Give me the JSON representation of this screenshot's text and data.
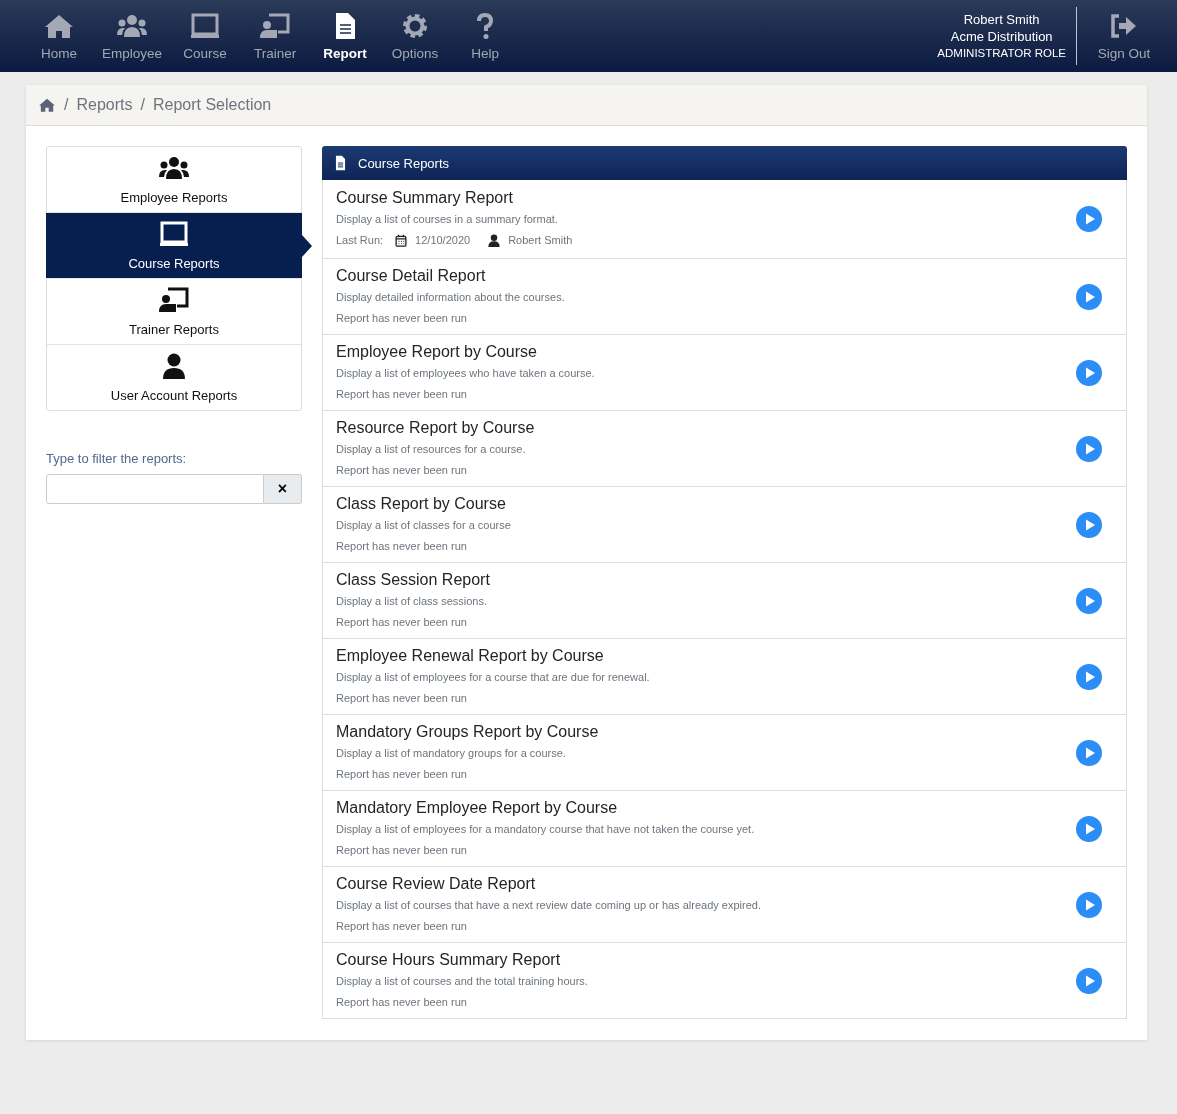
{
  "nav": [
    {
      "label": "Home",
      "kind": "home",
      "selected": false
    },
    {
      "label": "Employee",
      "kind": "users",
      "selected": false
    },
    {
      "label": "Course",
      "kind": "board",
      "selected": false
    },
    {
      "label": "Trainer",
      "kind": "trainer",
      "selected": false
    },
    {
      "label": "Report",
      "kind": "file",
      "selected": true
    },
    {
      "label": "Options",
      "kind": "gear",
      "selected": false
    },
    {
      "label": "Help",
      "kind": "help",
      "selected": false
    }
  ],
  "user": {
    "name": "Robert Smith",
    "company": "Acme Distribution",
    "role": "ADMINISTRATOR ROLE"
  },
  "sign_out": {
    "label": "Sign Out"
  },
  "breadcrumb": [
    {
      "separator": "/",
      "label": "Reports"
    },
    {
      "separator": "/",
      "label": "Report Selection"
    }
  ],
  "categories": [
    {
      "label": "Employee Reports",
      "kind": "users",
      "selected": false
    },
    {
      "label": "Course Reports",
      "kind": "board",
      "selected": true
    },
    {
      "label": "Trainer Reports",
      "kind": "trainer",
      "selected": false
    },
    {
      "label": "User Account Reports",
      "kind": "user",
      "selected": false
    }
  ],
  "filter": {
    "label": "Type to filter the reports:",
    "clear": "×"
  },
  "panel": {
    "title": "Course Reports"
  },
  "reports": [
    {
      "title": "Course Summary Report",
      "description": "Display a list of courses in a summary format.",
      "last_run": {
        "label": "Last Run:",
        "date": "12/10/2020",
        "user": "Robert Smith"
      }
    },
    {
      "title": "Course Detail Report",
      "description": "Display detailed information about the courses.",
      "status": "Report has never been run"
    },
    {
      "title": "Employee Report by Course",
      "description": "Display a list of employees who have taken a course.",
      "status": "Report has never been run"
    },
    {
      "title": "Resource Report by Course",
      "description": "Display a list of resources for a course.",
      "status": "Report has never been run"
    },
    {
      "title": "Class Report by Course",
      "description": "Display a list of classes for a course",
      "status": "Report has never been run"
    },
    {
      "title": "Class Session Report",
      "description": "Display a list of class sessions.",
      "status": "Report has never been run"
    },
    {
      "title": "Employee Renewal Report by Course",
      "description": "Display a list of employees for a course that are due for renewal.",
      "status": "Report has never been run"
    },
    {
      "title": "Mandatory Groups Report by Course",
      "description": "Display a list of mandatory groups for a course.",
      "status": "Report has never been run"
    },
    {
      "title": "Mandatory Employee Report by Course",
      "description": "Display a list of employees for a mandatory course that have not taken the course yet.",
      "status": "Report has never been run"
    },
    {
      "title": "Course Review Date Report",
      "description": "Display a list of courses that have a next review date coming up or has already expired.",
      "status": "Report has never been run"
    },
    {
      "title": "Course Hours Summary Report",
      "description": "Display a list of courses and the total training hours.",
      "status": "Report has never been run"
    }
  ]
}
